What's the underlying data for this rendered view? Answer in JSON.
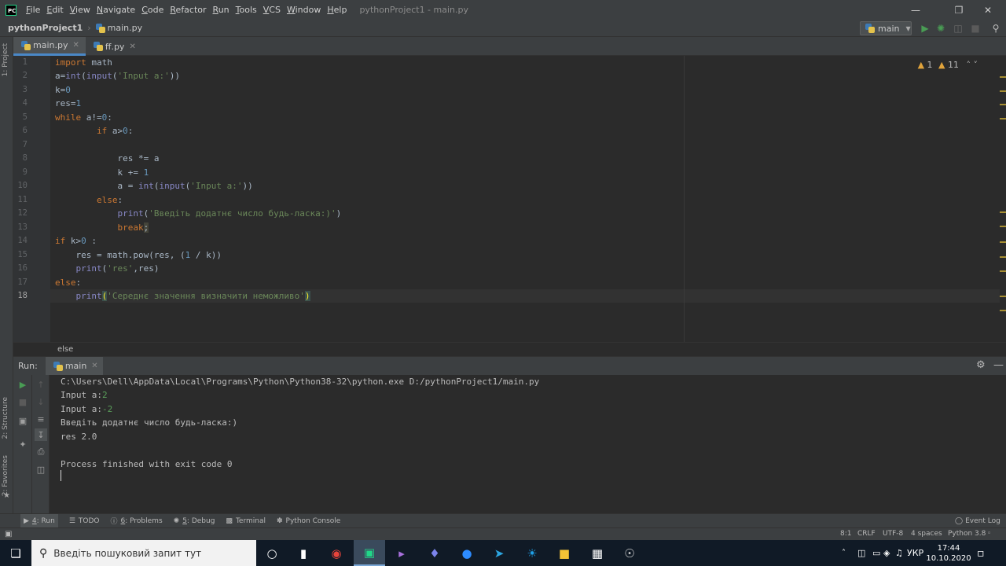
{
  "window": {
    "title": "pythonProject1 - main.py",
    "logo": "PC",
    "menu": [
      "File",
      "Edit",
      "View",
      "Navigate",
      "Code",
      "Refactor",
      "Run",
      "Tools",
      "VCS",
      "Window",
      "Help"
    ]
  },
  "navbar": {
    "project": "pythonProject1",
    "file": "main.py",
    "run_config": "main"
  },
  "side_panels": {
    "project": "1: Project",
    "structure": "2: Structure",
    "favorites": "2: Favorites"
  },
  "editor_tabs": [
    {
      "label": "main.py",
      "active": true
    },
    {
      "label": "ff.py",
      "active": false
    }
  ],
  "inspections": {
    "warnings": "1",
    "weak_warnings": "11"
  },
  "line_numbers": [
    "1",
    "2",
    "3",
    "4",
    "5",
    "6",
    "7",
    "8",
    "9",
    "10",
    "11",
    "12",
    "13",
    "14",
    "15",
    "16",
    "17",
    "18"
  ],
  "breadcrumb": "else",
  "run_panel": {
    "label": "Run:",
    "tab": "main",
    "console": {
      "cmd": "C:\\Users\\Dell\\AppData\\Local\\Programs\\Python\\Python38-32\\python.exe D:/pythonProject1/main.py",
      "prompt1": "Input a:",
      "input1": "2",
      "prompt2": "Input a:",
      "input2": "-2",
      "line3": "Введіть додатнє число будь-ласка:)",
      "line4": "res 2.0",
      "line5": "Process finished with exit code 0"
    }
  },
  "tool_windows": [
    {
      "num": "4",
      "label": ": Run"
    },
    {
      "num": "",
      "label": "TODO"
    },
    {
      "num": "6",
      "label": ": Problems"
    },
    {
      "num": "5",
      "label": ": Debug"
    },
    {
      "num": "",
      "label": "Terminal"
    },
    {
      "num": "",
      "label": "Python Console"
    }
  ],
  "event_log": "Event Log",
  "status": {
    "position": "8:1",
    "line_sep": "CRLF",
    "encoding": "UTF-8",
    "indent": "4 spaces",
    "interpreter": "Python 3.8"
  },
  "taskbar": {
    "search_placeholder": "Введіть пошуковий запит тут",
    "language": "УКР",
    "time": "17:44",
    "date": "10.10.2020"
  }
}
